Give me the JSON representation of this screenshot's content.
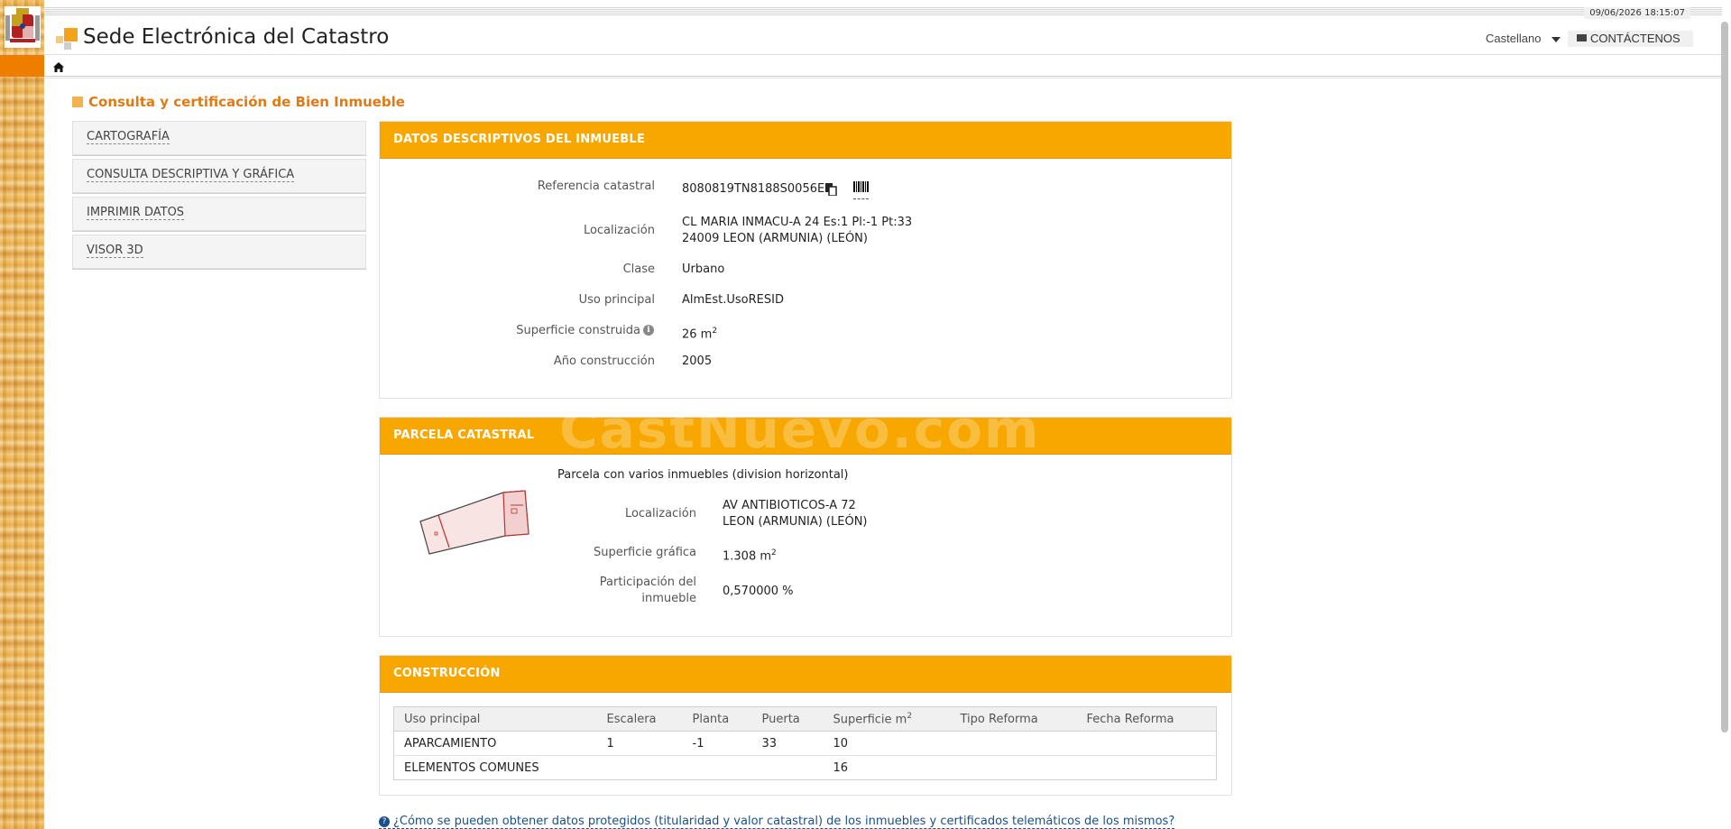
{
  "header": {
    "datetime": "09/06/2026  18:15:07",
    "site_title": "Sede Electrónica del Catastro",
    "language": "Castellano",
    "contact_label": "CONTÁCTENOS"
  },
  "page": {
    "title": "Consulta y certificación de Bien Inmueble"
  },
  "side_menu": [
    {
      "label": "CARTOGRAFÍA"
    },
    {
      "label": "CONSULTA DESCRIPTIVA Y GRÁFICA"
    },
    {
      "label": "IMPRIMIR DATOS"
    },
    {
      "label": "VISOR 3D"
    }
  ],
  "datos": {
    "header": "DATOS DESCRIPTIVOS DEL INMUEBLE",
    "ref_label": "Referencia catastral",
    "ref_value": "8080819TN8188S0056EU",
    "loc_label": "Localización",
    "loc_line1": "CL MARIA INMACU-A 24 Es:1 Pl:-1 Pt:33",
    "loc_line2": "24009 LEON (ARMUNIA) (LEÓN)",
    "clase_label": "Clase",
    "clase_value": "Urbano",
    "uso_label": "Uso principal",
    "uso_value": "AlmEst.UsoRESID",
    "sup_label": "Superficie construida",
    "sup_value": "26 m",
    "sup_unit_sup": "2",
    "anio_label": "Año construcción",
    "anio_value": "2005"
  },
  "parcela": {
    "header": "PARCELA CATASTRAL",
    "watermark": "CastNuevo.com",
    "desc": "Parcela con varios inmuebles (division horizontal)",
    "loc_label": "Localización",
    "loc_line1": "AV ANTIBIOTICOS-A 72",
    "loc_line2": "LEON (ARMUNIA) (LEÓN)",
    "sup_label": "Superficie gráfica",
    "sup_value": "1.308 m",
    "sup_unit_sup": "2",
    "part_label_1": "Participación del",
    "part_label_2": "inmueble",
    "part_value": "0,570000 %"
  },
  "construccion": {
    "header": "CONSTRUCCIÓN",
    "columns": [
      "Uso principal",
      "Escalera",
      "Planta",
      "Puerta",
      "Superficie m",
      "Tipo Reforma",
      "Fecha Reforma"
    ],
    "sup_col_sup": "2",
    "rows": [
      [
        "APARCAMIENTO",
        "1",
        "-1",
        "33",
        "10",
        "",
        ""
      ],
      [
        "ELEMENTOS COMUNES",
        "",
        "",
        "",
        "16",
        "",
        ""
      ]
    ]
  },
  "help_link": "¿Cómo se pueden obtener datos protegidos (titularidad y valor catastral) de los inmuebles y certificados telemáticos de los mismos?",
  "colors": {
    "accent": "#f7a700",
    "title": "#e07a14",
    "link": "#1a4f8a"
  }
}
